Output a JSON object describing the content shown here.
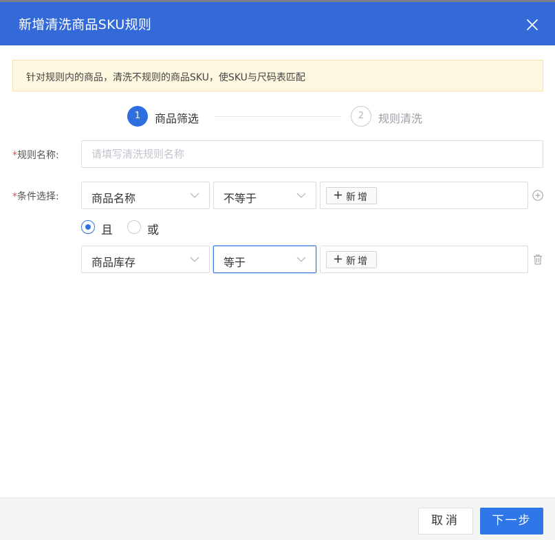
{
  "dialog": {
    "title": "新增清洗商品SKU规则"
  },
  "notice": {
    "text": "针对规则内的商品，清洗不规则的商品SKU，使SKU与尺码表匹配"
  },
  "steps": [
    {
      "number": "1",
      "label": "商品筛选",
      "status": "active"
    },
    {
      "number": "2",
      "label": "规则清洗",
      "status": "inactive"
    }
  ],
  "form": {
    "rule_name": {
      "required_mark": "*",
      "label": "规则名称:",
      "value": "",
      "placeholder": "请填写清洗规则名称"
    },
    "conditions": {
      "required_mark": "*",
      "label": "条件选择:",
      "rows": [
        {
          "field": "商品名称",
          "operator": "不等于",
          "add_label": "新增",
          "action_icon": "plus-circle-icon"
        },
        {
          "field": "商品库存",
          "operator": "等于",
          "add_label": "新增",
          "action_icon": "trash-icon"
        }
      ],
      "logic": {
        "options": [
          "且",
          "或"
        ],
        "selected": "且"
      }
    }
  },
  "footer": {
    "cancel_label": "取消",
    "next_label": "下一步"
  },
  "colors": {
    "header_bg": "#3469d8",
    "primary": "#2f76e9",
    "required": "#e24b4b",
    "notice_bg": "#fff8e1"
  }
}
